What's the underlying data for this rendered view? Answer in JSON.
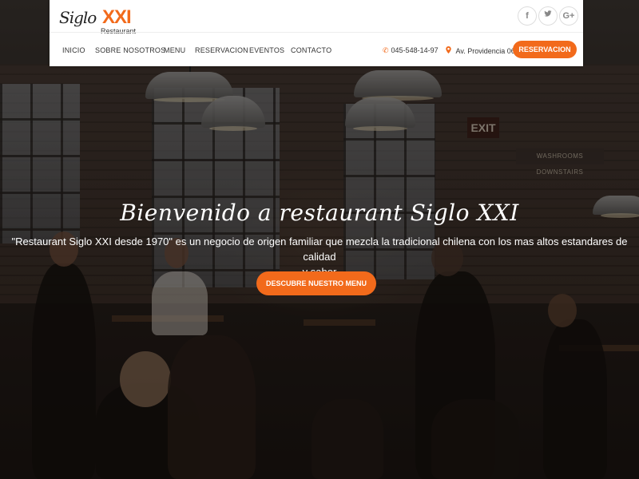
{
  "brand": {
    "logo_script": "Siglo",
    "logo_roman": "XXI",
    "logo_sub": "Restaurant",
    "accent": "#f26a1b"
  },
  "social": [
    {
      "icon": "facebook-icon",
      "glyph": "f"
    },
    {
      "icon": "twitter-icon",
      "glyph": "🐦"
    },
    {
      "icon": "google-plus-icon",
      "glyph": "G+"
    }
  ],
  "nav": {
    "items": [
      "INICIO",
      "SOBRE NOSOTROS",
      "MENU",
      "RESERVACION",
      "EVENTOS",
      "CONTACTO"
    ],
    "phone": "045-548-14-97",
    "address": "Av. Providencia 068",
    "reserve_label": "RESERVACION"
  },
  "hero": {
    "title": "Bienvenido a restaurant Siglo XXI",
    "description_line1": "\"Restaurant Siglo XXI desde 1970\" es un negocio de origen familiar que mezcla la tradicional chilena con los mas altos estandares de calidad",
    "description_line2": "y sabor",
    "cta_label": "DESCUBRE NUESTRO MENU",
    "sign_exit": "EXIT",
    "sign_washrooms": "WASHROOMS DOWNSTAIRS"
  }
}
